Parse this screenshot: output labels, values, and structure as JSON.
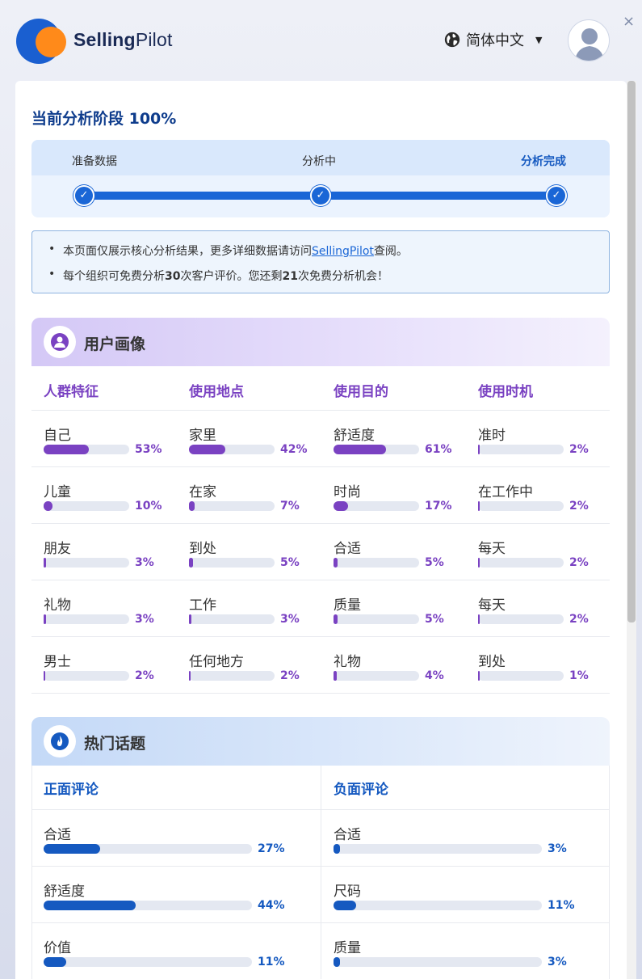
{
  "header": {
    "brand_bold": "Selling",
    "brand_light": "Pilot",
    "language": "简体中文",
    "language_icon": "globe-icon",
    "close": "×"
  },
  "stage": {
    "title": "当前分析阶段 100%",
    "progress": 1.0,
    "steps": [
      "准备数据",
      "分析中",
      "分析完成"
    ]
  },
  "notice": {
    "line1_prefix": "本页面仅展示核心分析结果，更多详细数据请访问",
    "line1_link": "SellingPilot",
    "line1_suffix": "查阅。",
    "line2_a": "每个组织可免费分析",
    "line2_b": "30",
    "line2_c": "次客户评价。您还剩",
    "line2_d": "21",
    "line2_e": "次免费分析机会！"
  },
  "persona": {
    "title": "用户画像",
    "icon": "user-icon",
    "color": "#7a42c2",
    "columns": [
      {
        "header": "人群特征",
        "items": [
          [
            "自己",
            53
          ],
          [
            "儿童",
            10
          ],
          [
            "朋友",
            3
          ],
          [
            "礼物",
            3
          ],
          [
            "男士",
            2
          ]
        ]
      },
      {
        "header": "使用地点",
        "items": [
          [
            "家里",
            42
          ],
          [
            "在家",
            7
          ],
          [
            "到处",
            5
          ],
          [
            "工作",
            3
          ],
          [
            "任何地方",
            2
          ]
        ]
      },
      {
        "header": "使用目的",
        "items": [
          [
            "舒适度",
            61
          ],
          [
            "时尚",
            17
          ],
          [
            "合适",
            5
          ],
          [
            "质量",
            5
          ],
          [
            "礼物",
            4
          ]
        ]
      },
      {
        "header": "使用时机",
        "items": [
          [
            "准时",
            2
          ],
          [
            "在工作中",
            2
          ],
          [
            "每天",
            2
          ],
          [
            "每天",
            2
          ],
          [
            "到处",
            1
          ]
        ]
      }
    ]
  },
  "topics": {
    "title": "热门话题",
    "icon": "fire-icon",
    "color": "#1559c0",
    "columns": [
      {
        "header": "正面评论",
        "items": [
          [
            "合适",
            27
          ],
          [
            "舒适度",
            44
          ],
          [
            "价值",
            11
          ]
        ]
      },
      {
        "header": "负面评论",
        "items": [
          [
            "合适",
            3
          ],
          [
            "尺码",
            11
          ],
          [
            "质量",
            3
          ]
        ]
      }
    ]
  }
}
